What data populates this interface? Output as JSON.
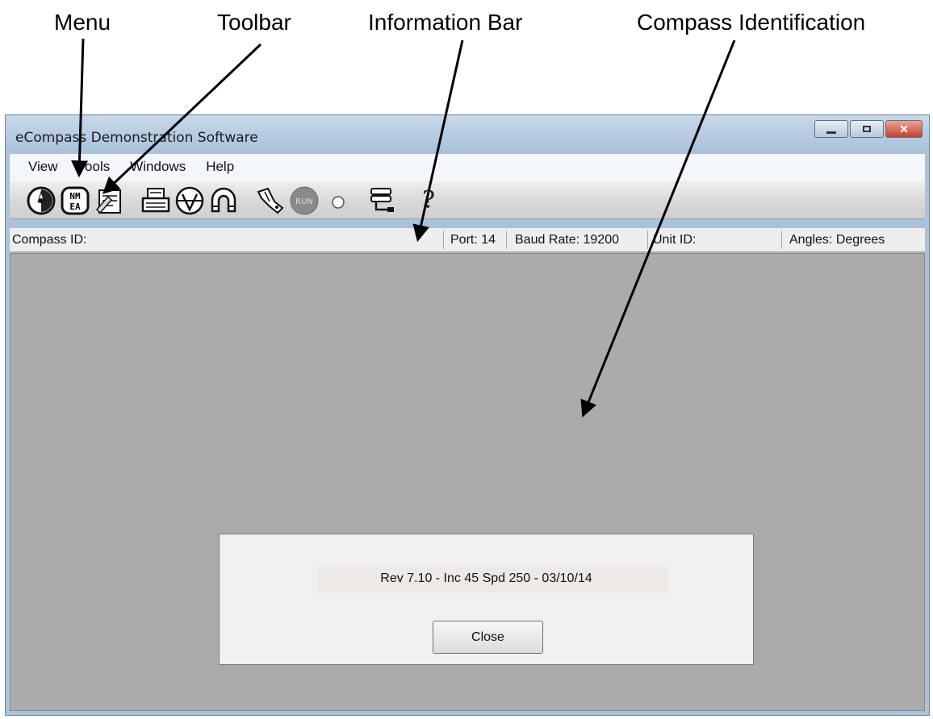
{
  "callouts": {
    "menu": "Menu",
    "toolbar": "Toolbar",
    "information_bar": "Information Bar",
    "compass_identification": "Compass Identification"
  },
  "window": {
    "title": "eCompass Demonstration Software",
    "controls": {
      "minimize": "minimize-icon",
      "maximize": "maximize-icon",
      "close": "close-icon",
      "close_glyph": "✕"
    }
  },
  "menu": {
    "items": [
      {
        "label": "View"
      },
      {
        "label": "Tools"
      },
      {
        "label": "Windows"
      },
      {
        "label": "Help"
      }
    ]
  },
  "toolbar": {
    "icons": [
      "compass-icon",
      "nmea-icon",
      "notepad-icon",
      "printer-icon",
      "heading-dial-icon",
      "magnet-icon",
      "pointer-hand-icon",
      "run-icon",
      "circle-icon",
      "cable-connector-icon",
      "help-icon"
    ],
    "nmea_text_top": "NM",
    "nmea_text_bottom": "EA",
    "run_text": "RUN",
    "help_glyph": "?"
  },
  "info_bar": {
    "compass_id": "Compass ID:",
    "port": "Port: 14",
    "baud_rate": "Baud Rate:  19200",
    "unit_id": "Unit ID:",
    "angles": "Angles:  Degrees"
  },
  "dialog": {
    "revision": "Rev 7.10 - Inc 45 Spd 250 - 03/10/14",
    "close_label": "Close"
  }
}
